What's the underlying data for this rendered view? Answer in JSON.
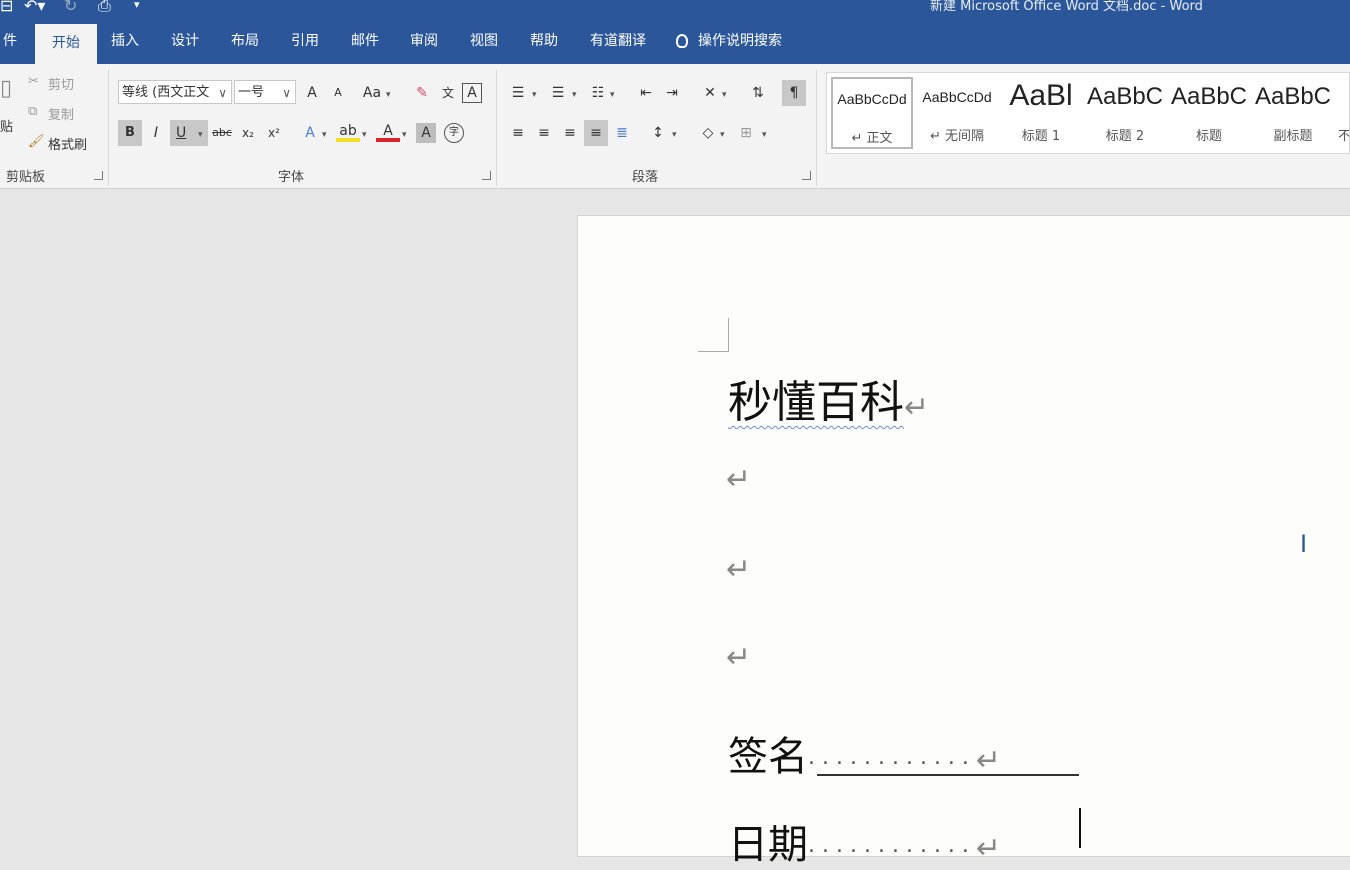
{
  "title_bar": {
    "text": "新建 Microsoft Office Word 文档.doc - Word"
  },
  "tabs": [
    {
      "label": "件"
    },
    {
      "label": "开始"
    },
    {
      "label": "插入"
    },
    {
      "label": "设计"
    },
    {
      "label": "布局"
    },
    {
      "label": "引用"
    },
    {
      "label": "邮件"
    },
    {
      "label": "审阅"
    },
    {
      "label": "视图"
    },
    {
      "label": "帮助"
    },
    {
      "label": "有道翻译"
    }
  ],
  "active_tab": "开始",
  "tell_me": {
    "label": "操作说明搜索"
  },
  "clipboard": {
    "paste_label": "贴",
    "cut_label": "剪切",
    "copy_label": "复制",
    "format_painter_label": "格式刷",
    "group_label": "剪贴板"
  },
  "font": {
    "font_name": "等线 (西文正文",
    "font_size": "一号",
    "group_label": "字体",
    "grow": "A",
    "shrink": "A",
    "case": "Aa",
    "bold": "B",
    "italic": "I",
    "underline": "U",
    "strike": "abc",
    "subscript": "x₂",
    "superscript": "x²",
    "font_color": "A",
    "char_shading": "A",
    "enclose": "字"
  },
  "paragraph": {
    "group_label": "段落"
  },
  "styles": [
    {
      "preview": "AaBbCcDd",
      "name": "↵ 正文"
    },
    {
      "preview": "AaBbCcDd",
      "name": "↵ 无间隔"
    },
    {
      "preview": "AaBl",
      "name": "标题 1"
    },
    {
      "preview": "AaBbC",
      "name": "标题 2"
    },
    {
      "preview": "AaBbC",
      "name": "标题"
    },
    {
      "preview": "AaBbC",
      "name": "副标题"
    },
    {
      "preview": "",
      "name": "不"
    }
  ],
  "document": {
    "heading": "秒懂百科",
    "paragraph_mark": "↵",
    "signature_label": "签名",
    "date_label": "日期",
    "leader_dots": "............"
  },
  "colors": {
    "ribbon_blue": "#2b579a",
    "ribbon_bg": "#f3f3f3"
  }
}
